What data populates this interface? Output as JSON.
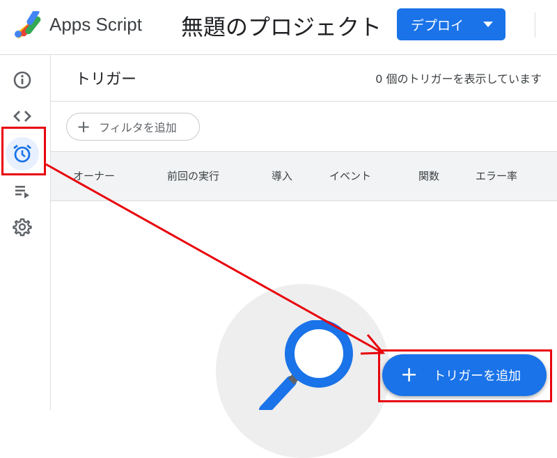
{
  "header": {
    "app_name": "Apps Script",
    "project_title": "無題のプロジェクト",
    "deploy_label": "デプロイ"
  },
  "rail": {
    "items": [
      {
        "name": "overview",
        "icon": "info-icon"
      },
      {
        "name": "editor",
        "icon": "code-icon"
      },
      {
        "name": "triggers",
        "icon": "alarm-clock-icon",
        "active": true
      },
      {
        "name": "executions",
        "icon": "playlist-play-icon"
      },
      {
        "name": "settings",
        "icon": "gear-icon"
      }
    ]
  },
  "main": {
    "title": "トリガー",
    "count_text": "0 個のトリガーを表示しています",
    "filter_label": "フィルタを追加",
    "columns": [
      "オーナー",
      "前回の実行",
      "導入",
      "イベント",
      "関数",
      "エラー率"
    ],
    "add_trigger_label": "トリガーを追加"
  },
  "colors": {
    "accent": "#1a73e8",
    "highlight": "#e8000b",
    "active_nav_bg": "#e8f0fe"
  }
}
